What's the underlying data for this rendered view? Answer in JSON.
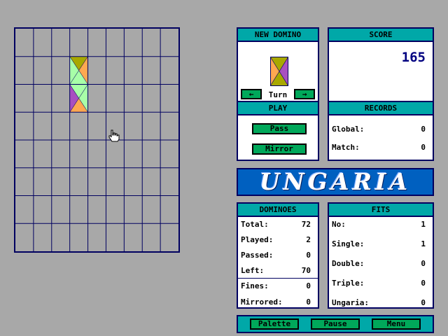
{
  "panels": {
    "new_domino": {
      "title": "NEW DOMINO",
      "turn_label": "Turn",
      "left_arrow": "←",
      "right_arrow": "→"
    },
    "score": {
      "title": "SCORE",
      "value": "165"
    },
    "play": {
      "title": "PLAY",
      "pass_label": "Pass",
      "mirror_label": "Mirror"
    },
    "records": {
      "title": "RECORDS",
      "items": [
        {
          "label": "Global:",
          "value": "0"
        },
        {
          "label": "Match:",
          "value": "0"
        }
      ]
    },
    "banner": {
      "text": "UNGARIA"
    },
    "dominoes": {
      "title": "DOMINOES",
      "items": [
        {
          "label": "Total:",
          "value": "72"
        },
        {
          "label": "Played:",
          "value": "2"
        },
        {
          "label": "Passed:",
          "value": "0"
        },
        {
          "label": "Left:",
          "value": "70"
        }
      ],
      "extra": [
        {
          "label": "Fines:",
          "value": "0"
        },
        {
          "label": "Mirrored:",
          "value": "0"
        }
      ]
    },
    "fits": {
      "title": "FITS",
      "items": [
        {
          "label": "No:",
          "value": "1"
        },
        {
          "label": "Single:",
          "value": "1"
        },
        {
          "label": "Double:",
          "value": "0"
        },
        {
          "label": "Triple:",
          "value": "0"
        },
        {
          "label": "Ungaria:",
          "value": "0"
        }
      ]
    }
  },
  "bottom_bar": {
    "palette_label": "Palette",
    "pause_label": "Pause",
    "menu_label": "Menu"
  },
  "board": {
    "columns": 9,
    "rows": 8,
    "placed_dominoes": [
      {
        "col": 3,
        "row": 1,
        "top": [
          "#a8a800",
          "#ffa850",
          "#a8ffa8",
          "#a8ffa8"
        ],
        "bottom": [
          "#a8ffa8",
          "#a8ffa8",
          "#ffa850",
          "#a850c0"
        ]
      }
    ]
  },
  "new_domino": {
    "colors": [
      "#a8a800",
      "#a850c0",
      "#a8a800",
      "#ffa850"
    ]
  },
  "colors": {
    "teal": "#00a8a8",
    "green": "#00a85a",
    "navy": "#000060",
    "banner_blue": "#0060c0"
  }
}
